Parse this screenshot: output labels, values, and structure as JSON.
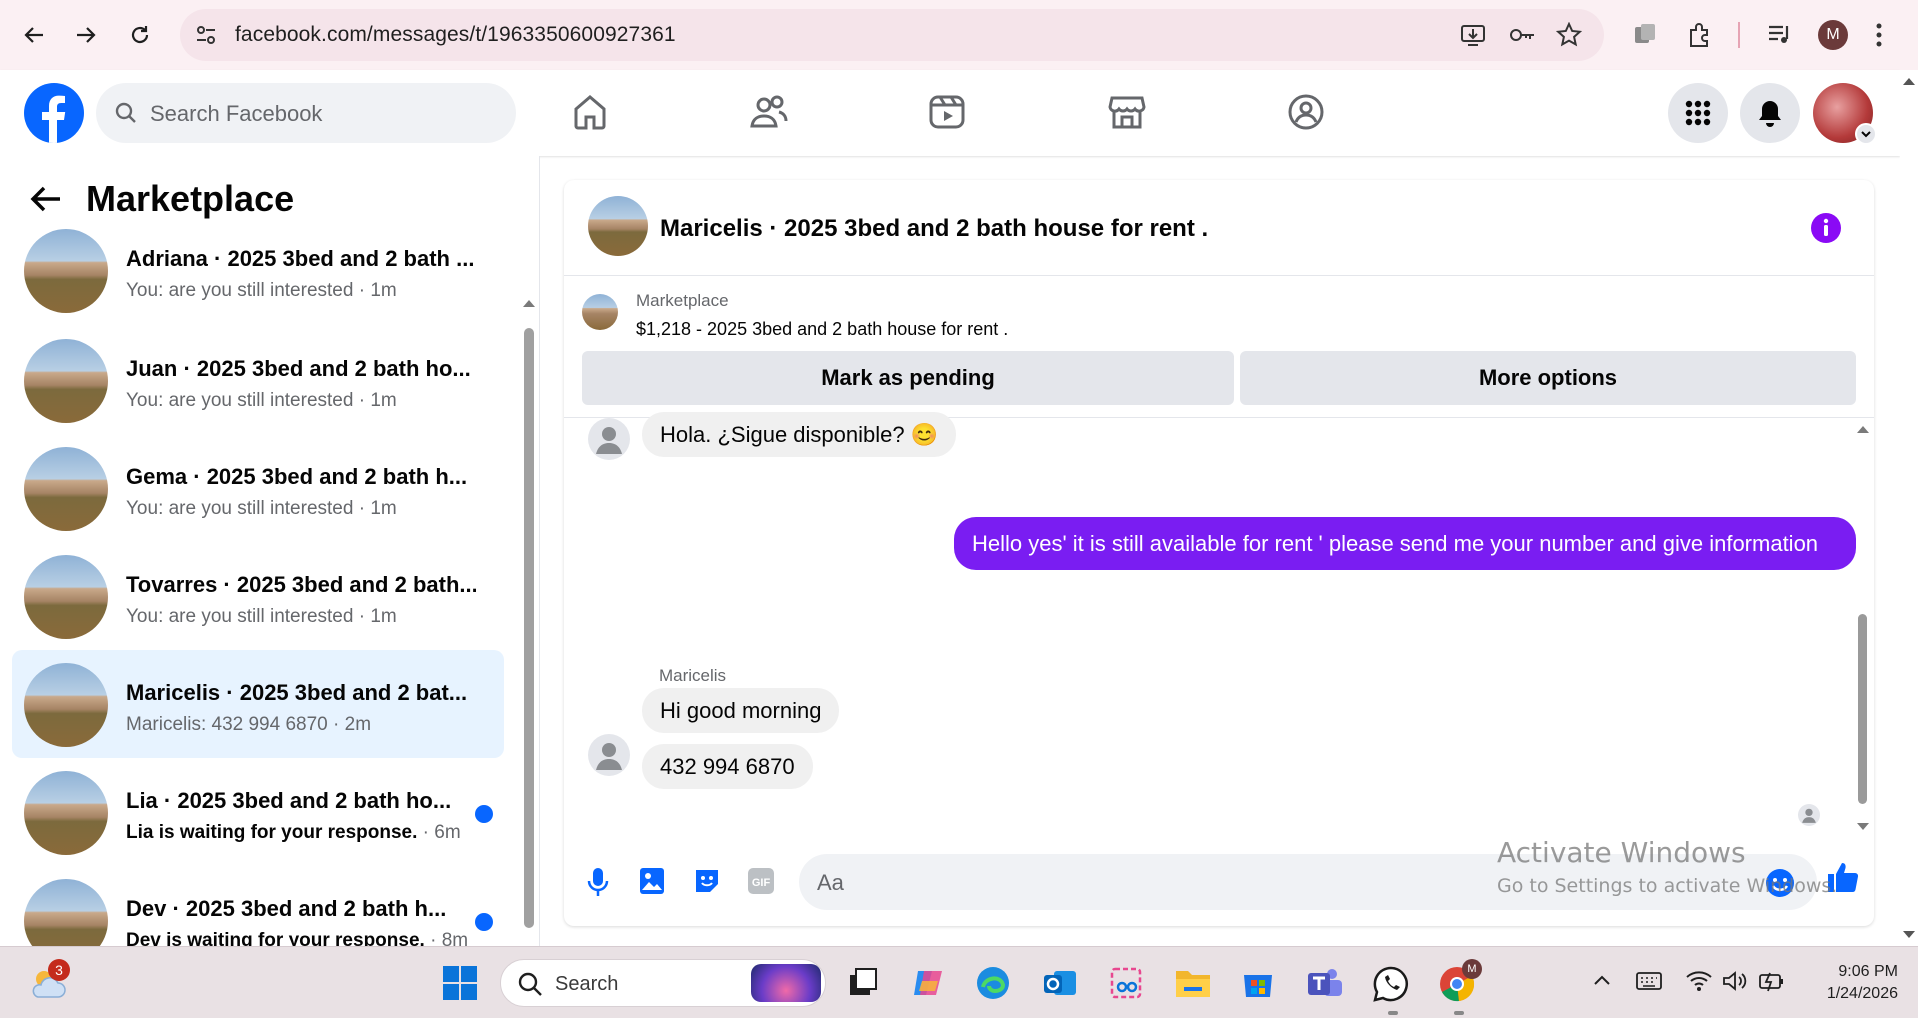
{
  "browser": {
    "url": "facebook.com/messages/t/1963350600927361",
    "profile_initial": "M"
  },
  "fb": {
    "search_placeholder": "Search Facebook"
  },
  "marketplace": {
    "title": "Marketplace",
    "conversations": [
      {
        "name": "Adriana · 2025 3bed and 2 bath ...",
        "preview": "You: are you still interested",
        "time": "1m",
        "unread": false,
        "active": false
      },
      {
        "name": "Juan · 2025 3bed and 2 bath ho...",
        "preview": "You: are you still interested",
        "time": "1m",
        "unread": false,
        "active": false
      },
      {
        "name": "Gema · 2025 3bed and 2 bath h...",
        "preview": "You: are you still interested",
        "time": "1m",
        "unread": false,
        "active": false
      },
      {
        "name": "Tovarres · 2025 3bed and 2 bath...",
        "preview": "You: are you still interested",
        "time": "1m",
        "unread": false,
        "active": false
      },
      {
        "name": "Maricelis · 2025 3bed and 2 bat...",
        "preview": "Maricelis: 432 994 6870",
        "time": "2m",
        "unread": false,
        "active": true
      },
      {
        "name": "Lia · 2025 3bed and 2 bath ho...",
        "preview": "Lia is waiting for your response.",
        "time": "6m",
        "unread": true,
        "active": false
      },
      {
        "name": "Dev · 2025 3bed and 2 bath h...",
        "preview": "Dev is waiting for your response.",
        "time": "8m",
        "unread": true,
        "active": false
      }
    ]
  },
  "chat": {
    "title": "Maricelis · 2025 3bed and 2 bath house for rent .",
    "banner_label": "Marketplace",
    "banner_listing": "$1,218 - 2025 3bed and 2 bath house for rent .",
    "mark_pending_label": "Mark as pending",
    "more_options_label": "More options",
    "messages": [
      {
        "from": "them",
        "text": "Hola. ¿Sigue disponible? 😊"
      },
      {
        "from": "me",
        "text": "Hello yes' it is still available for rent ' please send me your number and give information"
      },
      {
        "from": "them",
        "sender": "Maricelis",
        "text": "Hi good morning"
      },
      {
        "from": "them",
        "text": "432 994 6870"
      }
    ],
    "composer_placeholder": "Aa"
  },
  "watermark": {
    "line1": "Activate Windows",
    "line2": "Go to Settings to activate Windows."
  },
  "taskbar": {
    "search_label": "Search",
    "weather_badge": "3",
    "time": "9:06 PM",
    "date": "1/24/2026"
  },
  "colors": {
    "fb_blue": "#0866ff",
    "messenger_purple": "#7a1df2",
    "active_row": "#e7f3ff"
  }
}
